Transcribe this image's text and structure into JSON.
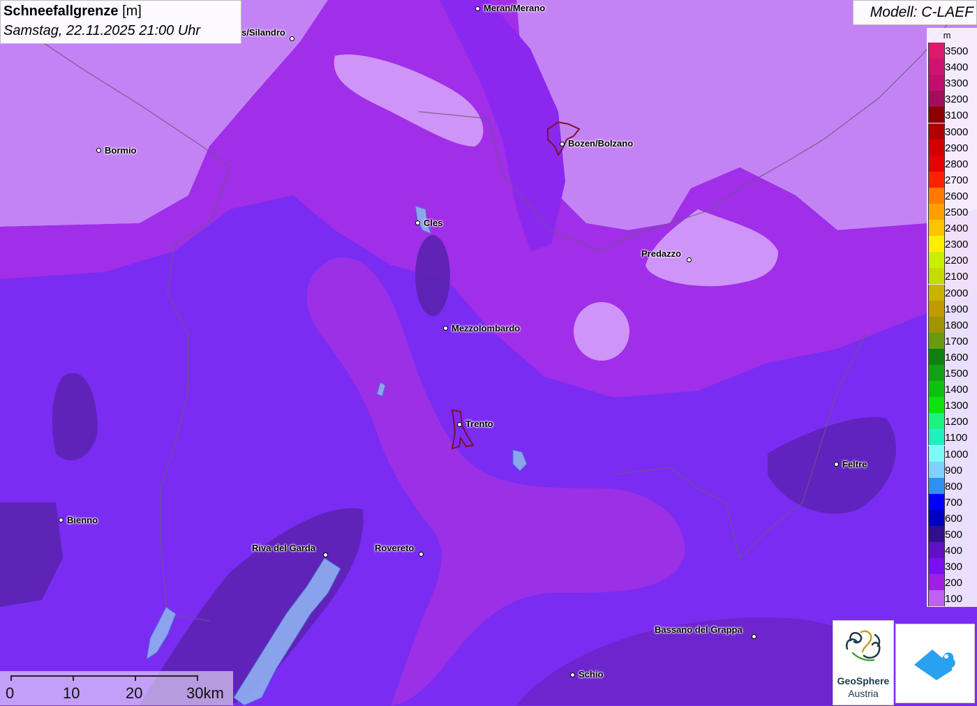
{
  "title": {
    "main_bold": "Schneefallgrenze",
    "main_unit": " [m]",
    "subtitle": "Samstag, 22.11.2025 21:00 Uhr"
  },
  "model": "Modell: C-LAEF",
  "legend": {
    "unit": "m",
    "entries": [
      {
        "label": "3500",
        "color": "#d81b6a"
      },
      {
        "label": "3400",
        "color": "#cc1570"
      },
      {
        "label": "3300",
        "color": "#c0106e"
      },
      {
        "label": "3200",
        "color": "#a0105a"
      },
      {
        "label": "3100",
        "color": "#8b0000"
      },
      {
        "label": "3000",
        "color": "#b00000"
      },
      {
        "label": "2900",
        "color": "#d00000"
      },
      {
        "label": "2800",
        "color": "#e60000"
      },
      {
        "label": "2700",
        "color": "#ff2000"
      },
      {
        "label": "2600",
        "color": "#ff7a00"
      },
      {
        "label": "2500",
        "color": "#ffa000"
      },
      {
        "label": "2400",
        "color": "#ffc400"
      },
      {
        "label": "2300",
        "color": "#ffee00"
      },
      {
        "label": "2200",
        "color": "#c8f000"
      },
      {
        "label": "2100",
        "color": "#c4dc00"
      },
      {
        "label": "2000",
        "color": "#c8b400"
      },
      {
        "label": "1900",
        "color": "#c09a00"
      },
      {
        "label": "1800",
        "color": "#a09400"
      },
      {
        "label": "1700",
        "color": "#6a9a10"
      },
      {
        "label": "1600",
        "color": "#108010"
      },
      {
        "label": "1500",
        "color": "#14a014"
      },
      {
        "label": "1400",
        "color": "#10c010"
      },
      {
        "label": "1300",
        "color": "#10e010"
      },
      {
        "label": "1200",
        "color": "#20f080"
      },
      {
        "label": "1100",
        "color": "#20f0c0"
      },
      {
        "label": "1000",
        "color": "#80f8f8"
      },
      {
        "label": "900",
        "color": "#80d0ff"
      },
      {
        "label": "800",
        "color": "#3090f0"
      },
      {
        "label": "700",
        "color": "#0000ff"
      },
      {
        "label": "600",
        "color": "#0000c0"
      },
      {
        "label": "500",
        "color": "#30108a"
      },
      {
        "label": "400",
        "color": "#6010c0"
      },
      {
        "label": "300",
        "color": "#7a10f0"
      },
      {
        "label": "200",
        "color": "#a020e0"
      },
      {
        "label": "100",
        "color": "#c060f0"
      }
    ]
  },
  "cities": [
    {
      "name": "Meran/Merano"
    },
    {
      "name": "s/Silandro"
    },
    {
      "name": "Bormio"
    },
    {
      "name": "Bozen/Bolzano"
    },
    {
      "name": "Cles"
    },
    {
      "name": "Predazzo"
    },
    {
      "name": "Mezzolombardo"
    },
    {
      "name": "Trento"
    },
    {
      "name": "Feltre"
    },
    {
      "name": "Bienno"
    },
    {
      "name": "Riva del Garda"
    },
    {
      "name": "Rovereto"
    },
    {
      "name": "Bassano del Grappa"
    },
    {
      "name": "Schio"
    }
  ],
  "scalebar": {
    "labels": [
      "0",
      "10",
      "20",
      "30km"
    ]
  },
  "logos": {
    "geosphere_name": "GeoSphere",
    "geosphere_sub": "Austria"
  }
}
